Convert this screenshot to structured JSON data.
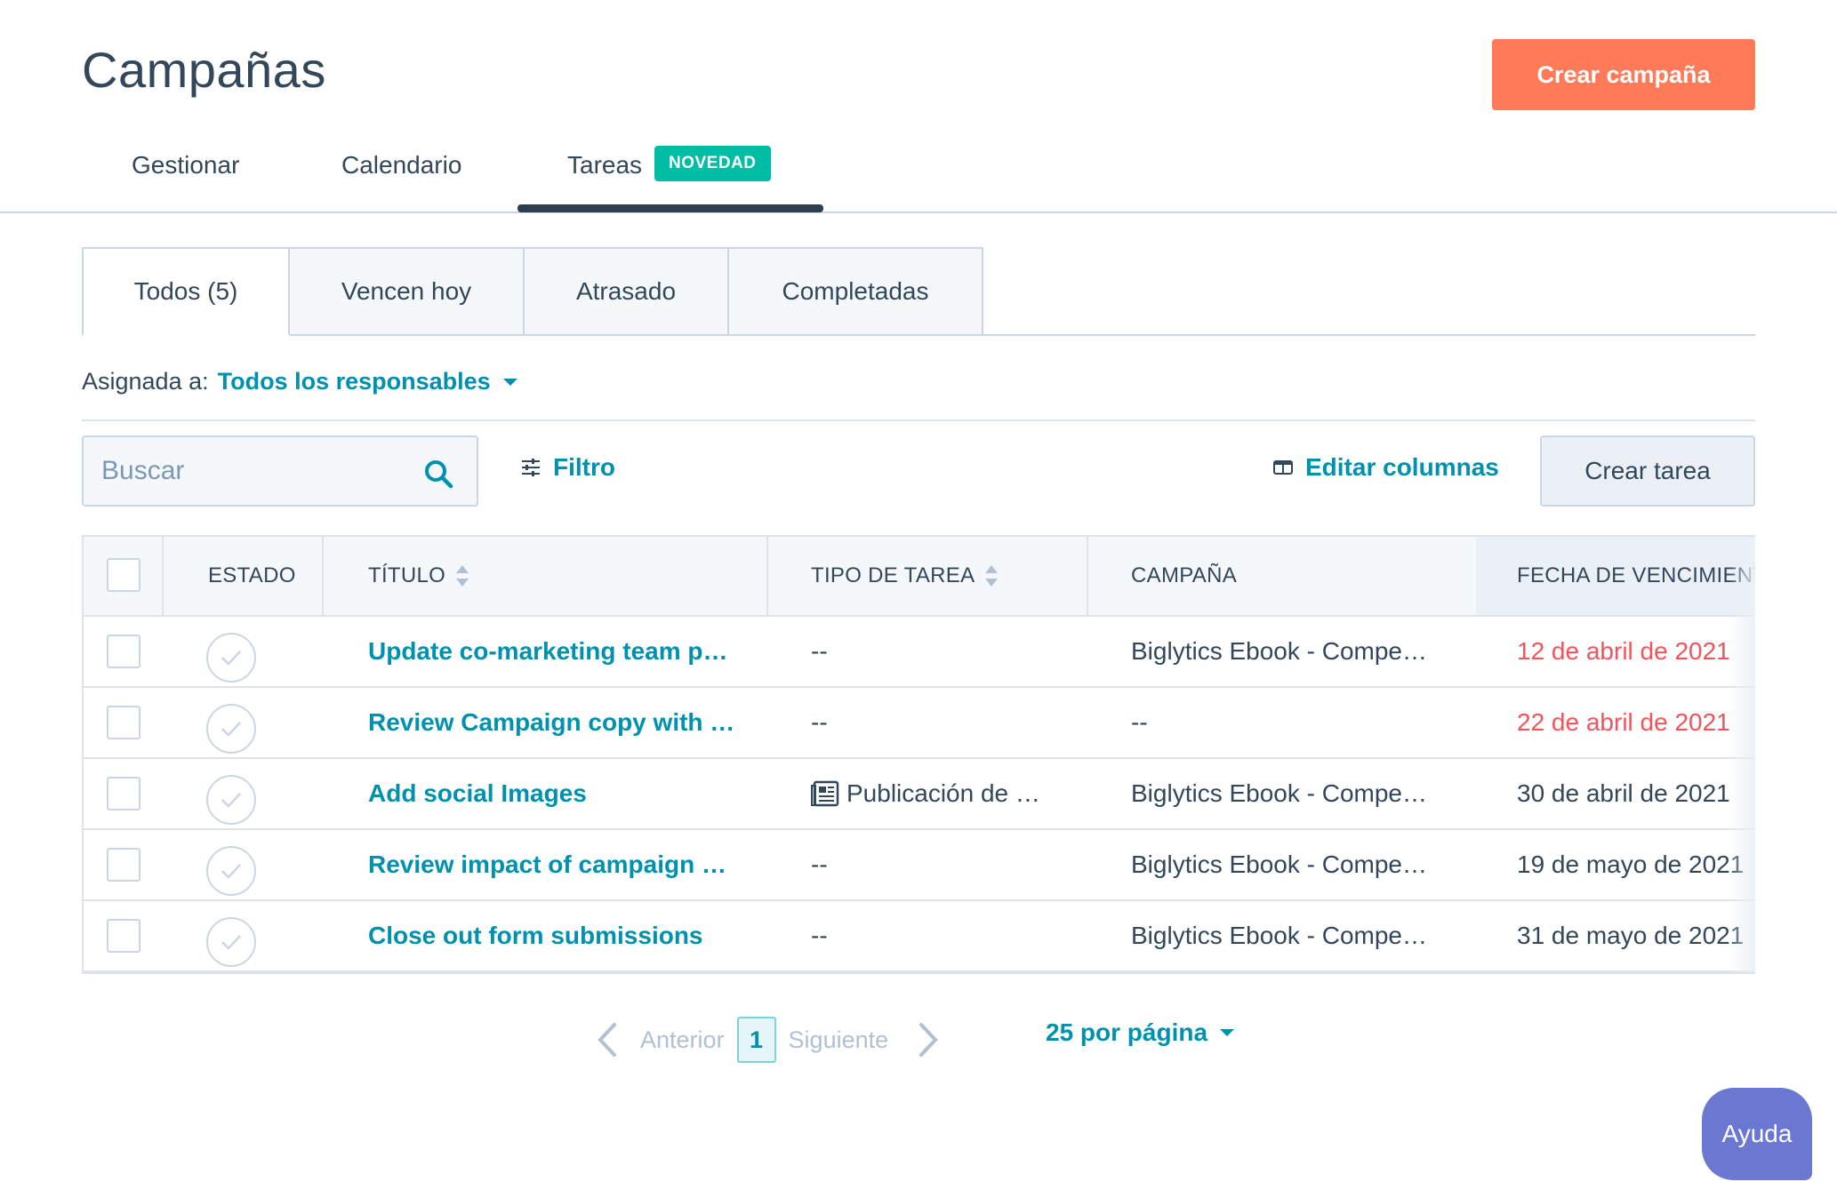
{
  "header": {
    "title": "Campañas",
    "create_button": "Crear campaña"
  },
  "main_tabs": [
    {
      "label": "Gestionar"
    },
    {
      "label": "Calendario"
    },
    {
      "label": "Tareas",
      "active": true,
      "badge": "NOVEDAD"
    }
  ],
  "sub_tabs": [
    {
      "label": "Todos (5)",
      "active": true
    },
    {
      "label": "Vencen hoy"
    },
    {
      "label": "Atrasado"
    },
    {
      "label": "Completadas"
    }
  ],
  "assigned": {
    "label": "Asignada a:",
    "value": "Todos los responsables"
  },
  "toolbar": {
    "search_placeholder": "Buscar",
    "filter_label": "Filtro",
    "edit_columns_label": "Editar columnas",
    "create_task_label": "Crear tarea"
  },
  "table": {
    "columns": [
      "ESTADO",
      "TÍTULO",
      "TIPO DE TAREA",
      "CAMPAÑA",
      "FECHA DE VENCIMIENT"
    ],
    "rows": [
      {
        "title": "Update co-marketing team p…",
        "type": "--",
        "campaign": "Biglytics Ebook - Compe…",
        "due": "12 de abril de 2021",
        "overdue": true
      },
      {
        "title": "Review Campaign copy with …",
        "type": "--",
        "campaign": "--",
        "due": "22 de abril de 2021",
        "overdue": true
      },
      {
        "title": "Add social Images",
        "type": "Publicación de …",
        "type_icon": "social-post-icon",
        "campaign": "Biglytics Ebook - Compe…",
        "due": "30 de abril de 2021",
        "overdue": false
      },
      {
        "title": "Review impact of campaign …",
        "type": "--",
        "campaign": "Biglytics Ebook - Compe…",
        "due": "19 de mayo de 2021",
        "overdue": false
      },
      {
        "title": "Close out form submissions",
        "type": "--",
        "campaign": "Biglytics Ebook - Compe…",
        "due": "31 de mayo de 2021",
        "overdue": false
      }
    ]
  },
  "pagination": {
    "prev": "Anterior",
    "current": "1",
    "next": "Siguiente",
    "per_page": "25 por página"
  },
  "help": {
    "label": "Ayuda"
  },
  "colors": {
    "accent": "#ff7a59",
    "link": "#0091ae",
    "overdue": "#f2545b",
    "badge": "#00bda5",
    "help": "#6a78d1"
  }
}
